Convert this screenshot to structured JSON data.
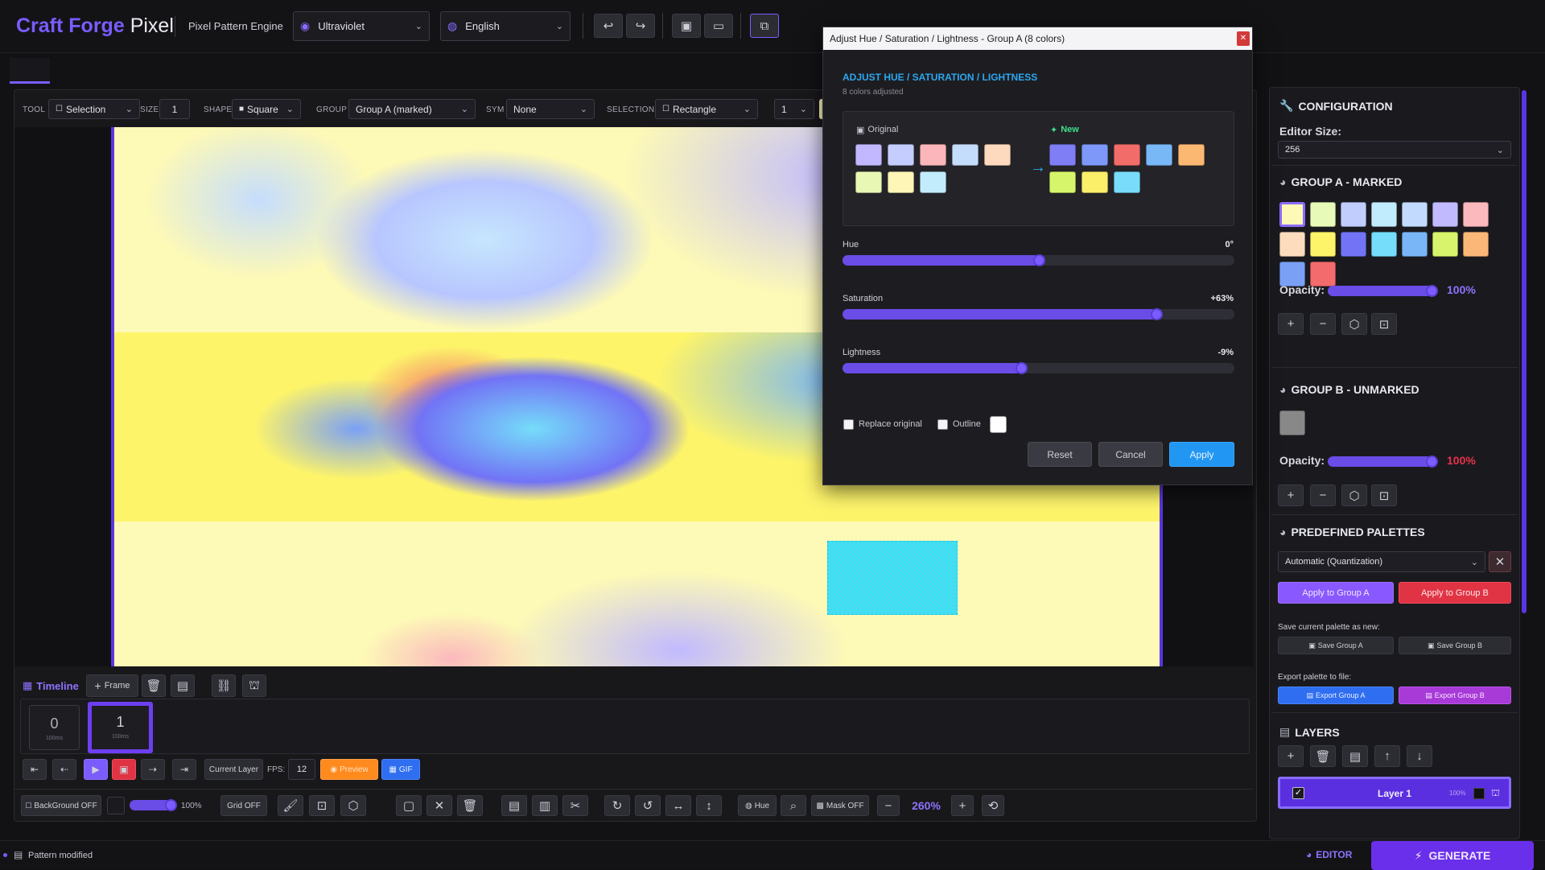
{
  "app": {
    "brand_a": "Craft Forge",
    "brand_b": "Pixel",
    "subtitle": "Pixel Pattern Engine"
  },
  "header": {
    "theme_value": "Ultraviolet",
    "language_value": "English"
  },
  "toolbar": {
    "tool_label": "TOOL",
    "tool_value": "Selection",
    "size_label": "SIZE",
    "size_value": "1",
    "shape_label": "SHAPE",
    "shape_value": "Square",
    "group_label": "GROUP",
    "group_value": "Group A (marked)",
    "sym_label": "SYM",
    "sym_value": "None",
    "selection_label": "SELECTION",
    "selection_value": "Rectangle",
    "extra_value": "1"
  },
  "dialog": {
    "window_title": "Adjust Hue / Saturation / Lightness - Group A (8 colors)",
    "heading": "ADJUST HUE / SATURATION / LIGHTNESS",
    "subheading": "8 colors adjusted",
    "original_label": "Original",
    "new_label": "New",
    "original_colors": [
      "#c2b8ff",
      "#c4cdfd",
      "#fbb6bb",
      "#c5ddfd",
      "#fdd9bd",
      "#e9f7b5",
      "#fdf6b7",
      "#c2ecfc"
    ],
    "new_colors": [
      "#7f7ef4",
      "#7d98f8",
      "#f26c6a",
      "#79b8f6",
      "#fbb873",
      "#d7f56a",
      "#fbee69",
      "#79dcfa"
    ],
    "hue_label": "Hue",
    "hue_value": "0°",
    "hue_fraction": 0.5,
    "saturation_label": "Saturation",
    "saturation_value": "+63%",
    "saturation_fraction": 0.8,
    "lightness_label": "Lightness",
    "lightness_value": "-9%",
    "lightness_fraction": 0.455,
    "replace_label": "Replace original",
    "outline_label": "Outline",
    "reset": "Reset",
    "cancel": "Cancel",
    "apply": "Apply"
  },
  "sidebar": {
    "config_title": "CONFIGURATION",
    "editor_size_label": "Editor Size:",
    "editor_size_value": "256",
    "group_a_title": "GROUP A - MARKED",
    "group_a_colors": [
      "#fdf9b6",
      "#e7fab8",
      "#c1cdfd",
      "#c0ecfd",
      "#c1dafd",
      "#c1baff",
      "#fbb8bd",
      "#fddbbd",
      "#fdf46a",
      "#7273f5",
      "#75dcfa",
      "#78b6f7",
      "#d8f46c",
      "#fbb777",
      "#7aa0f6",
      "#f36b6d"
    ],
    "opacity_label": "Opacity:",
    "group_a_opacity": "100%",
    "group_b_title": "GROUP B - UNMARKED",
    "group_b_colors": [
      "#888888"
    ],
    "group_b_opacity": "100%",
    "palettes_title": "PREDEFINED PALETTES",
    "palette_value": "Automatic (Quantization)",
    "apply_a": "Apply to Group A",
    "apply_b": "Apply to Group B",
    "save_label": "Save current palette as new:",
    "save_a": "Save Group A",
    "save_b": "Save Group B",
    "export_label": "Export palette to file:",
    "export_a": "Export Group A",
    "export_b": "Export Group B",
    "layers_title": "LAYERS",
    "layer_name": "Layer 1",
    "layer_opacity": "100%"
  },
  "timeline": {
    "title": "Timeline",
    "add_frame": "Frame",
    "frames": [
      {
        "number": "0",
        "duration": "100ms"
      },
      {
        "number": "1",
        "duration": "100ms"
      }
    ],
    "current_layer": "Current Layer",
    "fps_label": "FPS:",
    "fps_value": "12",
    "preview": "Preview",
    "gif": "GIF"
  },
  "bottombar": {
    "background": "BackGround OFF",
    "bg_opacity": "100%",
    "grid": "Grid OFF",
    "hue": "Hue",
    "mask": "Mask OFF",
    "zoom": "260%"
  },
  "status": {
    "text": "Pattern modified",
    "editor": "EDITOR",
    "generate": "GENERATE"
  }
}
